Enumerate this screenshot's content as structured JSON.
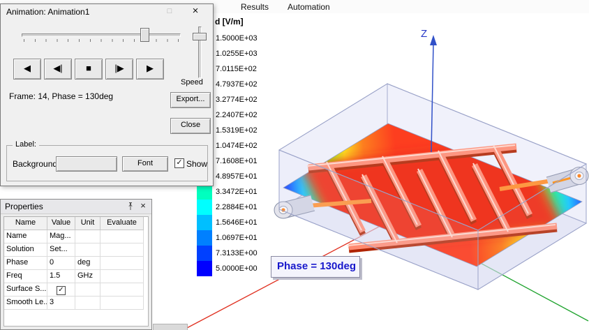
{
  "menu_bar": {
    "items": [
      {
        "label": "Results"
      },
      {
        "label": "Automation"
      }
    ]
  },
  "animation_dialog": {
    "title": "Animation: Animation1",
    "maximize_glyph": "□",
    "close_glyph": "×",
    "playback": {
      "play_reverse": "◀",
      "step_back": "◀|",
      "stop": "■",
      "step_forward": "|▶",
      "play_forward": "▶"
    },
    "speed_label": "Speed",
    "frame_status": "Frame: 14, Phase = 130deg",
    "export_button": "Export...",
    "close_button": "Close",
    "label_group": {
      "title": "Label:",
      "background_label": "Background:",
      "font_button": "Font",
      "show_label": "Show",
      "show_checked": true,
      "check_glyph": "✓"
    }
  },
  "properties_panel": {
    "title": "Properties",
    "close_glyph": "×",
    "check_glyph": "✓",
    "columns": [
      "Name",
      "Value",
      "Unit",
      "Evaluate"
    ],
    "rows": [
      {
        "name": "Name",
        "value": "Mag...",
        "unit": "",
        "evaluate": ""
      },
      {
        "name": "Solution",
        "value": "Set...",
        "unit": "",
        "evaluate": ""
      },
      {
        "name": "Phase",
        "value": "0",
        "unit": "deg",
        "evaluate": ""
      },
      {
        "name": "Freq",
        "value": "1.5",
        "unit": "GHz",
        "evaluate": ""
      },
      {
        "name": "Surface S...",
        "value": "",
        "unit": "",
        "evaluate": "",
        "checkbox": true
      },
      {
        "name": "Smooth Le...",
        "value": "3",
        "unit": "",
        "evaluate": ""
      }
    ]
  },
  "legend": {
    "title": "d [V/m]",
    "entries": [
      {
        "value": "1.5000E+03",
        "color": "#FF0000"
      },
      {
        "value": "1.0255E+03",
        "color": "#FF4000"
      },
      {
        "value": "7.0115E+02",
        "color": "#FF7F00"
      },
      {
        "value": "4.7937E+02",
        "color": "#FFBF00"
      },
      {
        "value": "3.2774E+02",
        "color": "#FFFF00"
      },
      {
        "value": "2.2407E+02",
        "color": "#BFFF00"
      },
      {
        "value": "1.5319E+02",
        "color": "#7FFF00"
      },
      {
        "value": "1.0474E+02",
        "color": "#40FF00"
      },
      {
        "value": "7.1608E+01",
        "color": "#00FF00"
      },
      {
        "value": "4.8957E+01",
        "color": "#00FF80"
      },
      {
        "value": "3.3472E+01",
        "color": "#00FFBF"
      },
      {
        "value": "2.2884E+01",
        "color": "#00FFFF"
      },
      {
        "value": "1.5646E+01",
        "color": "#00BFFF"
      },
      {
        "value": "1.0697E+01",
        "color": "#0080FF"
      },
      {
        "value": "7.3133E+00",
        "color": "#0040FF"
      },
      {
        "value": "5.0000E+00",
        "color": "#0000FF"
      }
    ]
  },
  "viewport": {
    "z_axis_label": "Z",
    "phase_annotation": "Phase = 130deg",
    "axis_colors": {
      "x_axis": "#e03020",
      "y_axis": "#1fa32e",
      "z_axis": "#3050c8"
    }
  }
}
